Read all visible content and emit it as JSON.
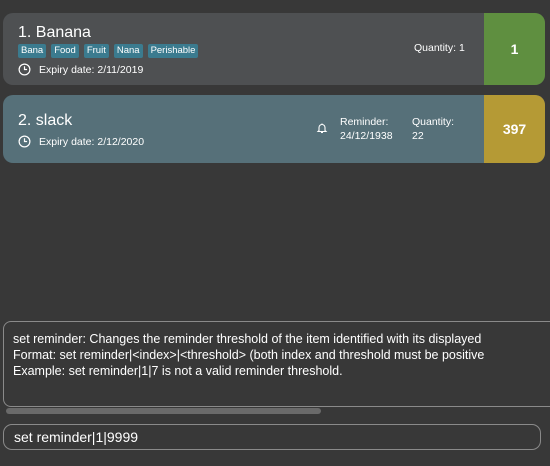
{
  "items": [
    {
      "title": "1.  Banana",
      "tags": [
        "Bana",
        "Food",
        "Fruit",
        "Nana",
        "Perishable"
      ],
      "expiry": "Expiry date: 2/11/2019",
      "quantity_label": "Quantity: 1",
      "number": "1",
      "color": "#5f8f40"
    },
    {
      "title": "2.  slack",
      "expiry": "Expiry date: 2/12/2020",
      "reminder_line1": "Reminder:",
      "reminder_line2": "24/12/1938",
      "quantity_line1": "Quantity:",
      "quantity_line2": "22",
      "number": "397",
      "color": "#b59a35"
    }
  ],
  "result_display": {
    "line1": "set reminder: Changes the reminder threshold of the item identified with its displayed",
    "line2": "Format: set reminder|<index>|<threshold> (both index and threshold must be positive",
    "line3": "Example: set reminder|1|7 is not a valid reminder threshold."
  },
  "command_box": {
    "value": "set reminder|1|9999"
  },
  "icons": [
    "clock-icon",
    "bell-icon"
  ]
}
